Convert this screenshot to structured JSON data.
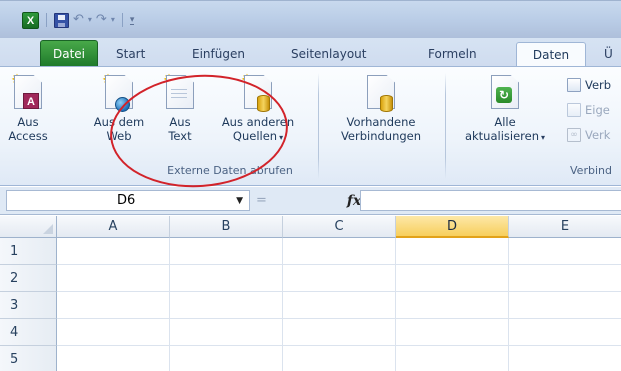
{
  "tabs": {
    "file": "Datei",
    "start": "Start",
    "insert": "Einfügen",
    "page_layout": "Seitenlayout",
    "formulas": "Formeln",
    "data": "Daten",
    "review_partial": "Ü"
  },
  "ribbon": {
    "external_data": {
      "group_label": "Externe Daten abrufen",
      "from_access": [
        "Aus",
        "Access"
      ],
      "from_web": [
        "Aus dem",
        "Web"
      ],
      "from_text": [
        "Aus",
        "Text"
      ],
      "from_other": [
        "Aus anderen",
        "Quellen"
      ]
    },
    "existing_connections": [
      "Vorhandene",
      "Verbindungen"
    ],
    "refresh_all": [
      "Alle",
      "aktualisieren"
    ],
    "connections": {
      "group_label_partial": "Verbind",
      "items": [
        "Verb",
        "Eige",
        "Verk"
      ]
    }
  },
  "formula_bar": {
    "name_box": "D6",
    "fx": "fx",
    "cancel_glyph": "=",
    "value": ""
  },
  "grid": {
    "columns": [
      "A",
      "B",
      "C",
      "D",
      "E"
    ],
    "active_column": "D",
    "rows": [
      "1",
      "2",
      "3",
      "4",
      "5"
    ]
  },
  "icons": {
    "app": "excel-logo-icon",
    "save": "save-icon",
    "undo": "undo-icon",
    "redo": "redo-icon"
  },
  "colors": {
    "file_tab": "#2a8a35",
    "active_column_header": "#f7cf5d",
    "annotation": "#d2232a"
  }
}
